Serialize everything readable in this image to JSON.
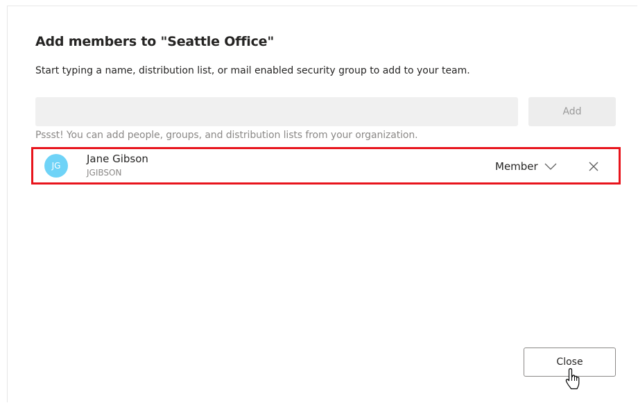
{
  "dialog": {
    "title": "Add members to \"Seattle Office\"",
    "subtitle": "Start typing a name, distribution list, or mail enabled security group to add to your team.",
    "search": {
      "value": "",
      "placeholder": ""
    },
    "add_label": "Add",
    "hint": "Pssst! You can add people, groups, and distribution lists from your organization.",
    "members": [
      {
        "initials": "JG",
        "name": "Jane Gibson",
        "id": "JGIBSON",
        "role": "Member",
        "avatar_color": "#6fd3f7"
      }
    ],
    "close_label": "Close"
  },
  "icons": {
    "role_dropdown": "chevron-down-icon",
    "remove": "close-icon",
    "pointer": "hand-pointer-icon"
  },
  "colors": {
    "highlight_border": "#e8141c",
    "input_background": "#f0f0f0",
    "hint_text": "#8a8886"
  }
}
